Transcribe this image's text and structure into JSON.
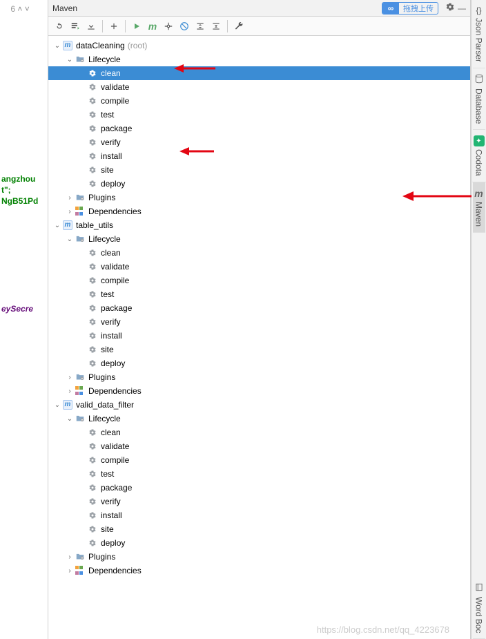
{
  "title": "Maven",
  "upload_label": "拖拽上传",
  "editor": {
    "line_num": "6",
    "frag1": "angzhou",
    "frag2": "t\";",
    "frag3": "NgB51Pd",
    "frag4": "eySecre"
  },
  "toolbar": {
    "refresh": "Refresh",
    "generate": "Generate Sources",
    "download": "Download",
    "add": "Add",
    "run": "Run",
    "m": "m",
    "skip": "Toggle Skip Tests",
    "offline": "Offline",
    "collapse": "Collapse",
    "expand": "Expand",
    "settings": "Settings"
  },
  "right_tabs": {
    "json_parser": "Json Parser",
    "database": "Database",
    "codota": "Codota",
    "maven": "Maven",
    "word_book": "Word Boc"
  },
  "watermark": "https://blog.csdn.net/qq_4223678",
  "tree": [
    {
      "d": 0,
      "t": "module",
      "exp": "open",
      "label": "dataCleaning",
      "suffix": "(root)"
    },
    {
      "d": 1,
      "t": "folder",
      "exp": "open",
      "label": "Lifecycle"
    },
    {
      "d": 2,
      "t": "goal",
      "label": "clean",
      "selected": true,
      "arrow": true
    },
    {
      "d": 2,
      "t": "goal",
      "label": "validate"
    },
    {
      "d": 2,
      "t": "goal",
      "label": "compile"
    },
    {
      "d": 2,
      "t": "goal",
      "label": "test"
    },
    {
      "d": 2,
      "t": "goal",
      "label": "package"
    },
    {
      "d": 2,
      "t": "goal",
      "label": "verify"
    },
    {
      "d": 2,
      "t": "goal",
      "label": "install",
      "arrow": true
    },
    {
      "d": 2,
      "t": "goal",
      "label": "site"
    },
    {
      "d": 2,
      "t": "goal",
      "label": "deploy"
    },
    {
      "d": 1,
      "t": "folder",
      "exp": "closed",
      "label": "Plugins"
    },
    {
      "d": 1,
      "t": "deps",
      "exp": "closed",
      "label": "Dependencies"
    },
    {
      "d": 0,
      "t": "module",
      "exp": "open",
      "label": "table_utils"
    },
    {
      "d": 1,
      "t": "folder",
      "exp": "open",
      "label": "Lifecycle"
    },
    {
      "d": 2,
      "t": "goal",
      "label": "clean"
    },
    {
      "d": 2,
      "t": "goal",
      "label": "validate"
    },
    {
      "d": 2,
      "t": "goal",
      "label": "compile"
    },
    {
      "d": 2,
      "t": "goal",
      "label": "test"
    },
    {
      "d": 2,
      "t": "goal",
      "label": "package"
    },
    {
      "d": 2,
      "t": "goal",
      "label": "verify"
    },
    {
      "d": 2,
      "t": "goal",
      "label": "install"
    },
    {
      "d": 2,
      "t": "goal",
      "label": "site"
    },
    {
      "d": 2,
      "t": "goal",
      "label": "deploy"
    },
    {
      "d": 1,
      "t": "folder",
      "exp": "closed",
      "label": "Plugins"
    },
    {
      "d": 1,
      "t": "deps",
      "exp": "closed",
      "label": "Dependencies"
    },
    {
      "d": 0,
      "t": "module",
      "exp": "open",
      "label": "valid_data_filter"
    },
    {
      "d": 1,
      "t": "folder",
      "exp": "open",
      "label": "Lifecycle"
    },
    {
      "d": 2,
      "t": "goal",
      "label": "clean"
    },
    {
      "d": 2,
      "t": "goal",
      "label": "validate"
    },
    {
      "d": 2,
      "t": "goal",
      "label": "compile"
    },
    {
      "d": 2,
      "t": "goal",
      "label": "test"
    },
    {
      "d": 2,
      "t": "goal",
      "label": "package"
    },
    {
      "d": 2,
      "t": "goal",
      "label": "verify"
    },
    {
      "d": 2,
      "t": "goal",
      "label": "install"
    },
    {
      "d": 2,
      "t": "goal",
      "label": "site"
    },
    {
      "d": 2,
      "t": "goal",
      "label": "deploy"
    },
    {
      "d": 1,
      "t": "folder",
      "exp": "closed",
      "label": "Plugins"
    },
    {
      "d": 1,
      "t": "deps",
      "exp": "closed",
      "label": "Dependencies"
    }
  ]
}
